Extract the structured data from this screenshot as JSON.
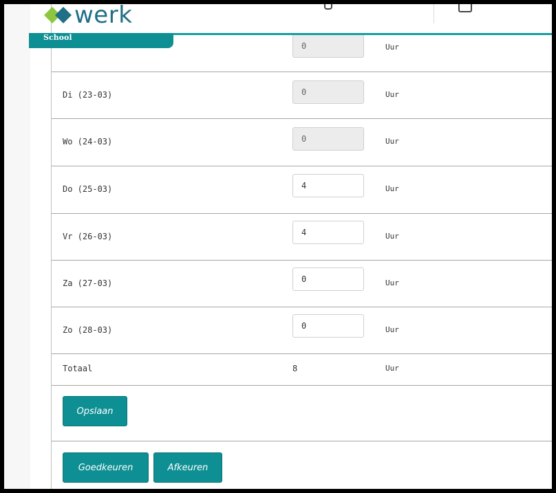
{
  "header": {
    "logo_text": "werk",
    "section_tab": "School"
  },
  "rows": [
    {
      "label": "",
      "value": "0",
      "unit": "Uur",
      "disabled": true
    },
    {
      "label": "Di (23-03)",
      "value": "0",
      "unit": "Uur",
      "disabled": true
    },
    {
      "label": "Wo (24-03)",
      "value": "0",
      "unit": "Uur",
      "disabled": true
    },
    {
      "label": "Do (25-03)",
      "value": "4",
      "unit": "Uur",
      "disabled": false
    },
    {
      "label": "Vr (26-03)",
      "value": "4",
      "unit": "Uur",
      "disabled": false
    },
    {
      "label": "Za (27-03)",
      "value": "0",
      "unit": "Uur",
      "disabled": false
    },
    {
      "label": "Zo (28-03)",
      "value": "0",
      "unit": "Uur",
      "disabled": false
    }
  ],
  "total": {
    "label": "Totaal",
    "value": "8",
    "unit": "Uur"
  },
  "buttons": {
    "save": "Opslaan",
    "approve": "Goedkeuren",
    "reject": "Afkeuren"
  },
  "colors": {
    "accent": "#0e8f93",
    "logo": "#1f6f86",
    "logo_diamond_light": "#8dc63f"
  }
}
